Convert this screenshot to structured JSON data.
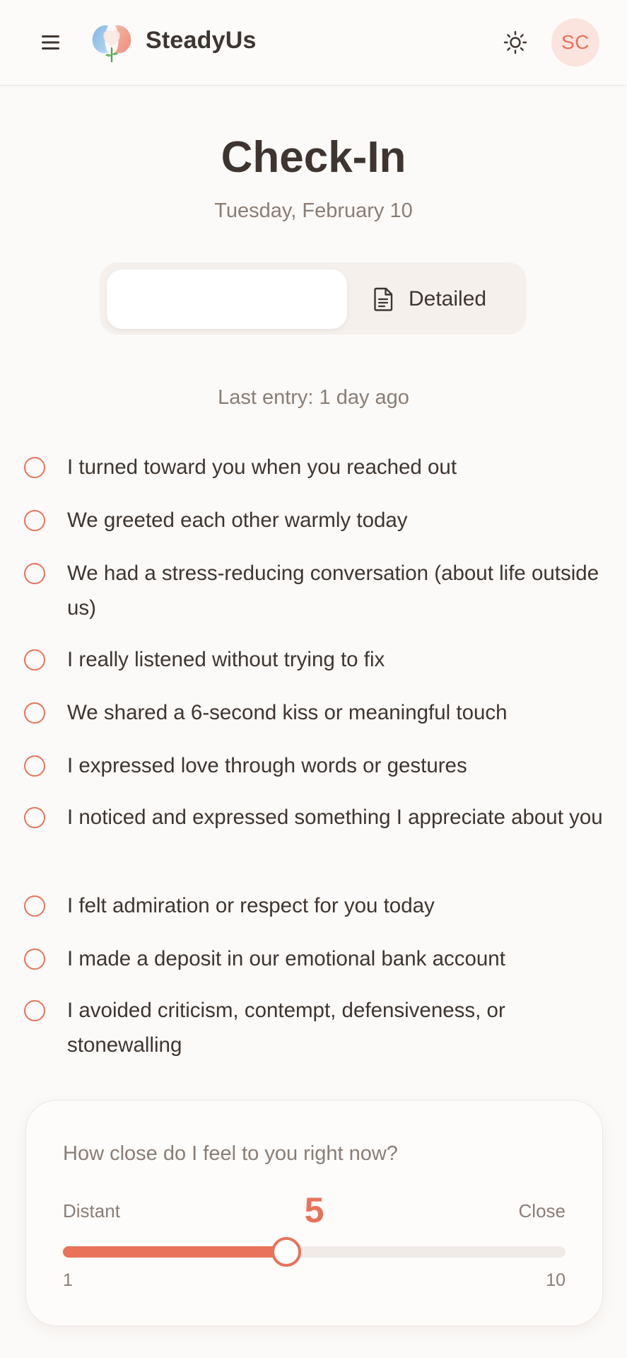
{
  "header": {
    "app_name": "SteadyUs",
    "avatar_initials": "SC",
    "icons": {
      "menu": "hamburger-menu-icon",
      "theme": "sun-icon",
      "logo": "steadyus-logo"
    }
  },
  "page": {
    "title": "Check-In",
    "date": "Tuesday, February 10"
  },
  "mode_toggle": {
    "options": [
      {
        "label": "",
        "selected": true
      },
      {
        "label": "Detailed",
        "icon": "document-icon",
        "selected": false
      }
    ]
  },
  "last_entry": "Last entry: 1 day ago",
  "checklist": {
    "items": [
      {
        "text": "I turned toward you when you reached out",
        "checked": false
      },
      {
        "text": "We greeted each other warmly today",
        "checked": false
      },
      {
        "text": "We had a stress-reducing conversation (about life outside us)",
        "checked": false
      },
      {
        "text": "I really listened without trying to fix",
        "checked": false
      },
      {
        "text": "We shared a 6-second kiss or meaningful touch",
        "checked": false
      },
      {
        "text": "I expressed love through words or gestures",
        "checked": false
      },
      {
        "text": "I noticed and expressed something I appreciate about you",
        "checked": false
      },
      {
        "text": "I felt admiration or respect for you today",
        "checked": false
      },
      {
        "text": "I made a deposit in our emotional bank account",
        "checked": false
      },
      {
        "text": "I avoided criticism, contempt, defensiveness, or stonewalling",
        "checked": false
      }
    ]
  },
  "closeness": {
    "question": "How close do I feel to you right now?",
    "left_label": "Distant",
    "right_label": "Close",
    "value": "5",
    "min": "1",
    "max": "10"
  },
  "colors": {
    "accent": "#e8735a",
    "text": "#3e3530",
    "muted": "#8b7d74",
    "background": "#fcfaf8",
    "avatar_bg": "#fbe3de"
  }
}
